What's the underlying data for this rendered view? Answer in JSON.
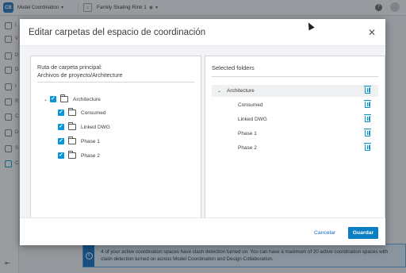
{
  "app": {
    "logo_text": "CB",
    "module_name": "Model Coordination",
    "project_name": "Family Skating Rink 1",
    "help_glyph": "?"
  },
  "sidebar": {
    "letters": [
      "I",
      "V",
      "D",
      "D",
      "I",
      "R",
      "C",
      "D",
      "S",
      "C"
    ]
  },
  "banner": {
    "text": "4 of your active coordination spaces have clash detection turned on. You can have a maximum of 20 active coordination spaces with clash detection turned on across Model Coordination and Design Collaboration.",
    "icon_glyph": "i"
  },
  "dialog": {
    "title": "Editar carpetas del espacio de coordinación",
    "close_glyph": "✕",
    "left_panel": {
      "path_label": "Ruta de carpeta principal:",
      "path_value": "Archivos de proyecto/Architecture",
      "tree": [
        {
          "label": "Architecture",
          "checked": true,
          "level": 0
        },
        {
          "label": "Consumed",
          "checked": true,
          "level": 1
        },
        {
          "label": "Linked DWG",
          "checked": true,
          "level": 1
        },
        {
          "label": "Phase 1",
          "checked": true,
          "level": 1
        },
        {
          "label": "Phase 2",
          "checked": true,
          "level": 1
        }
      ]
    },
    "right_panel": {
      "title": "Selected folders",
      "items": [
        {
          "label": "Architecture",
          "root": true
        },
        {
          "label": "Consumed",
          "root": false
        },
        {
          "label": "Linked DWG",
          "root": false
        },
        {
          "label": "Phase 1",
          "root": false
        },
        {
          "label": "Phase 2",
          "root": false
        }
      ]
    },
    "cancel_label": "Cancelar",
    "save_label": "Guardar",
    "check_glyph": "✓",
    "caret_glyph": "⌄"
  },
  "colors": {
    "accent": "#0696d7",
    "primary_button": "#0a7ec2",
    "banner_bg": "#d9e9f7",
    "banner_stripe": "#0a6cc2"
  }
}
